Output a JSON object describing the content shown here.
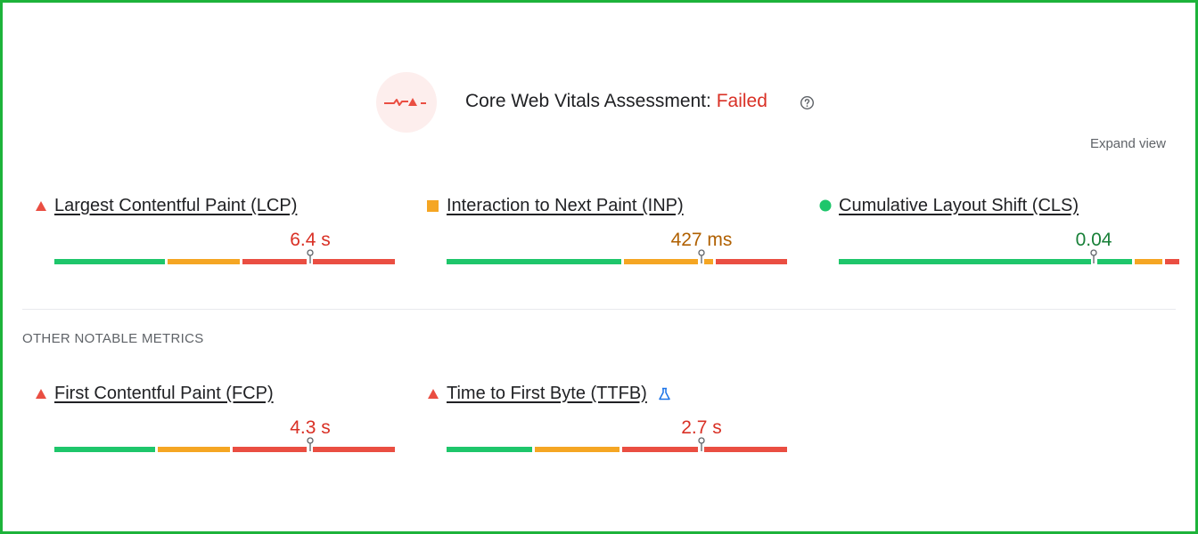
{
  "assessment": {
    "title_prefix": "Core Web Vitals Assessment: ",
    "status": "Failed",
    "status_color": "#d93025",
    "help_icon": "question-circle-icon",
    "icon": "pulse-warning-icon"
  },
  "expand_view_label": "Expand view",
  "core_metrics": [
    {
      "name": "Largest Contentful Paint (LCP)",
      "value": "6.4 s",
      "rating": "poor",
      "indicator": "red-triangle-icon",
      "value_color": "#d93025"
    },
    {
      "name": "Interaction to Next Paint (INP)",
      "value": "427 ms",
      "rating": "needs-improvement",
      "indicator": "orange-square-icon",
      "value_color": "#b06000"
    },
    {
      "name": "Cumulative Layout Shift (CLS)",
      "value": "0.04",
      "rating": "good",
      "indicator": "green-circle-icon",
      "value_color": "#188038"
    }
  ],
  "other_metrics_heading": "OTHER NOTABLE METRICS",
  "other_metrics": [
    {
      "name": "First Contentful Paint (FCP)",
      "value": "4.3 s",
      "rating": "poor",
      "indicator": "red-triangle-icon",
      "value_color": "#d93025"
    },
    {
      "name": "Time to First Byte (TTFB)",
      "value": "2.7 s",
      "rating": "poor",
      "indicator": "red-triangle-icon",
      "value_color": "#d93025",
      "badge": "experimental-flask-icon"
    }
  ],
  "colors": {
    "good": "#1ec66b",
    "needs_improvement": "#f5a623",
    "poor": "#ea4e42"
  }
}
